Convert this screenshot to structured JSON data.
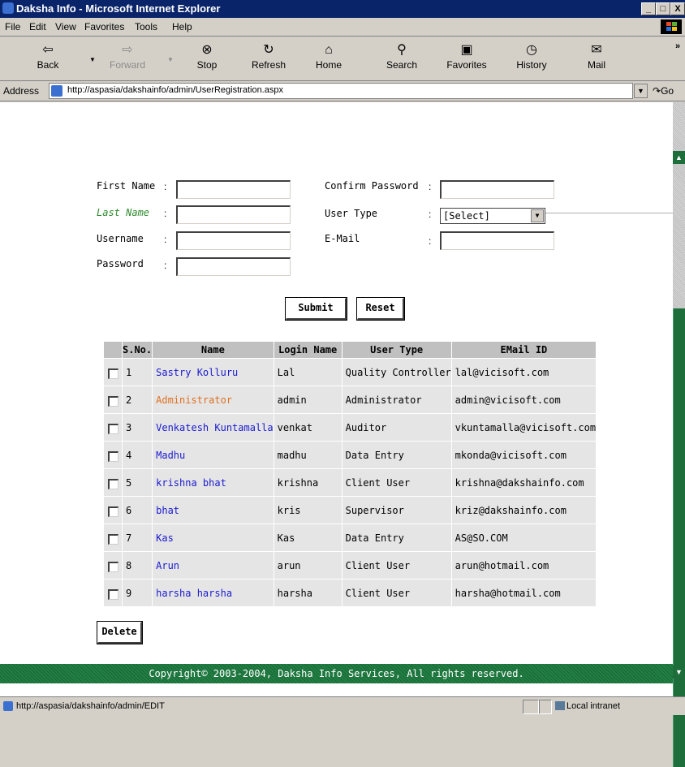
{
  "window": {
    "title": "Daksha Info - Microsoft Internet Explorer"
  },
  "menu": [
    "File",
    "Edit",
    "View",
    "Favorites",
    "Tools",
    "Help"
  ],
  "toolbar": {
    "back": "Back",
    "forward": "Forward",
    "stop": "Stop",
    "refresh": "Refresh",
    "home": "Home",
    "search": "Search",
    "favorites": "Favorites",
    "history": "History",
    "mail": "Mail"
  },
  "address": {
    "label": "Address",
    "url": "http://aspasia/dakshainfo/admin/UserRegistration.aspx",
    "go": "Go"
  },
  "form": {
    "first_name": "First Name",
    "last_name": "Last Name",
    "username": "Username",
    "password": "Password",
    "confirm_password": "Confirm Password",
    "user_type": "User Type",
    "email": "E-Mail",
    "colon": ":",
    "user_type_selected": "[Select]",
    "submit": "Submit",
    "reset": "Reset"
  },
  "table": {
    "headers": [
      "S.No.",
      "Name",
      "Login Name",
      "User Type",
      "EMail ID"
    ],
    "rows": [
      {
        "sno": "1",
        "name": "Sastry Kolluru",
        "login": "Lal",
        "type": "Quality Controller",
        "email": "lal@vicisoft.com"
      },
      {
        "sno": "2",
        "name": "Administrator",
        "login": "admin",
        "type": "Administrator",
        "email": "admin@vicisoft.com"
      },
      {
        "sno": "3",
        "name": "Venkatesh Kuntamalla",
        "login": "venkat",
        "type": "Auditor",
        "email": "vkuntamalla@vicisoft.com"
      },
      {
        "sno": "4",
        "name": "Madhu",
        "login": "madhu",
        "type": "Data Entry",
        "email": "mkonda@vicisoft.com"
      },
      {
        "sno": "5",
        "name": "krishna bhat",
        "login": "krishna",
        "type": "Client User",
        "email": "krishna@dakshainfo.com"
      },
      {
        "sno": "6",
        "name": "bhat",
        "login": "kris",
        "type": "Supervisor",
        "email": "kriz@dakshainfo.com"
      },
      {
        "sno": "7",
        "name": "Kas",
        "login": "Kas",
        "type": "Data Entry",
        "email": "AS@SO.COM"
      },
      {
        "sno": "8",
        "name": "Arun",
        "login": "arun",
        "type": "Client User",
        "email": "arun@hotmail.com"
      },
      {
        "sno": "9",
        "name": "harsha harsha",
        "login": "harsha",
        "type": "Client User",
        "email": "harsha@hotmail.com"
      }
    ],
    "delete": "Delete"
  },
  "footer": {
    "text": "Copyright© 2003-2004, Daksha Info Services, All rights reserved."
  },
  "status": {
    "url": "http://aspasia/dakshainfo/admin/EDIT",
    "zone": "Local intranet"
  },
  "colors": {
    "titlebar": "#0a246a",
    "footer": "#1e6e3c",
    "link": "#1a1ad0",
    "highlight": "#e07020"
  }
}
